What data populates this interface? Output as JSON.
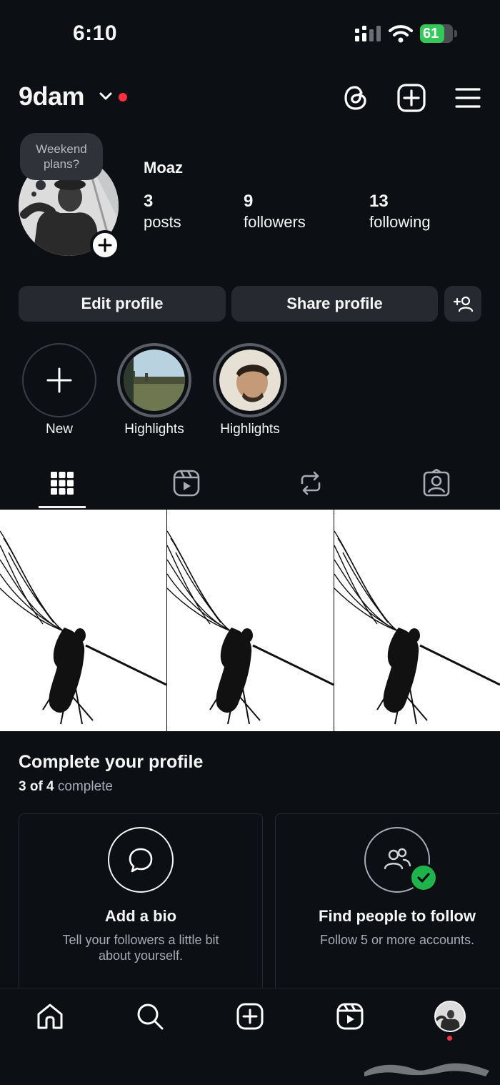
{
  "status_bar": {
    "time": "6:10",
    "battery_percent": "61"
  },
  "header": {
    "username": "9dam"
  },
  "profile": {
    "note": "Weekend plans?",
    "display_name": "Moaz",
    "stats": [
      {
        "value": "3",
        "label": "posts"
      },
      {
        "value": "9",
        "label": "followers"
      },
      {
        "value": "13",
        "label": "following"
      }
    ]
  },
  "actions": {
    "edit_label": "Edit profile",
    "share_label": "Share profile"
  },
  "highlights": [
    {
      "label": "New"
    },
    {
      "label": "Highlights"
    },
    {
      "label": "Highlights"
    }
  ],
  "tabs": [
    {
      "icon": "grid-icon",
      "active": true
    },
    {
      "icon": "reels-icon",
      "active": false
    },
    {
      "icon": "reposts-icon",
      "active": false
    },
    {
      "icon": "tagged-icon",
      "active": false
    }
  ],
  "posts_count_shown": 3,
  "complete_profile": {
    "title": "Complete your profile",
    "progress_strong": "3 of 4",
    "progress_rest": "complete",
    "cards": [
      {
        "title": "Add a bio",
        "desc_line1": "Tell your followers a little bit",
        "desc_line2": "about yourself.",
        "done": false
      },
      {
        "title": "Find people to follow",
        "desc_line1": "Follow 5 or more accounts.",
        "desc_line2": "",
        "done": true
      }
    ]
  },
  "colors": {
    "background": "#0c1014",
    "button": "#262a30",
    "accent_red": "#ff3040",
    "check_green": "#1fb34b"
  }
}
